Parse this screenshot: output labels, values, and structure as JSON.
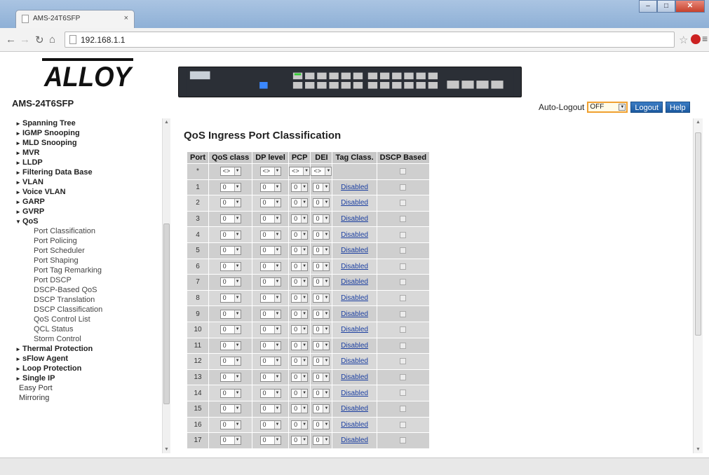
{
  "browser": {
    "tab_title": "AMS-24T6SFP",
    "tab_close": "×",
    "url": "192.168.1.1"
  },
  "header": {
    "logo_text": "ALLOY",
    "model": "AMS-24T6SFP",
    "auto_logout_label": "Auto-Logout",
    "auto_logout_value": "OFF",
    "logout_label": "Logout",
    "help_label": "Help"
  },
  "sidebar": {
    "items": [
      {
        "label": "Spanning Tree",
        "type": "collapsed"
      },
      {
        "label": "IGMP Snooping",
        "type": "collapsed"
      },
      {
        "label": "MLD Snooping",
        "type": "collapsed"
      },
      {
        "label": "MVR",
        "type": "collapsed"
      },
      {
        "label": "LLDP",
        "type": "collapsed"
      },
      {
        "label": "Filtering Data Base",
        "type": "collapsed"
      },
      {
        "label": "VLAN",
        "type": "collapsed"
      },
      {
        "label": "Voice VLAN",
        "type": "collapsed"
      },
      {
        "label": "GARP",
        "type": "collapsed"
      },
      {
        "label": "GVRP",
        "type": "collapsed"
      },
      {
        "label": "QoS",
        "type": "expanded"
      },
      {
        "label": "Port Classification",
        "type": "sub"
      },
      {
        "label": "Port Policing",
        "type": "sub"
      },
      {
        "label": "Port Scheduler",
        "type": "sub"
      },
      {
        "label": "Port Shaping",
        "type": "sub"
      },
      {
        "label": "Port Tag Remarking",
        "type": "sub"
      },
      {
        "label": "Port DSCP",
        "type": "sub"
      },
      {
        "label": "DSCP-Based QoS",
        "type": "sub"
      },
      {
        "label": "DSCP Translation",
        "type": "sub"
      },
      {
        "label": "DSCP Classification",
        "type": "sub"
      },
      {
        "label": "QoS Control List",
        "type": "sub"
      },
      {
        "label": "QCL Status",
        "type": "sub"
      },
      {
        "label": "Storm Control",
        "type": "sub"
      },
      {
        "label": "Thermal Protection",
        "type": "collapsed"
      },
      {
        "label": "sFlow Agent",
        "type": "collapsed"
      },
      {
        "label": "Loop Protection",
        "type": "collapsed"
      },
      {
        "label": "Single IP",
        "type": "collapsed"
      },
      {
        "label": "Easy Port",
        "type": "plain"
      },
      {
        "label": "Mirroring",
        "type": "plain"
      }
    ]
  },
  "main": {
    "title": "QoS Ingress Port Classification",
    "columns": [
      "Port",
      "QoS class",
      "DP level",
      "PCP",
      "DEI",
      "Tag Class.",
      "DSCP Based"
    ],
    "wildcard_row": {
      "port": "*",
      "select_value": "<>"
    },
    "rows": [
      {
        "port": "1",
        "qos_class": "0",
        "dp_level": "0",
        "pcp": "0",
        "dei": "0",
        "tag_class": "Disabled"
      },
      {
        "port": "2",
        "qos_class": "0",
        "dp_level": "0",
        "pcp": "0",
        "dei": "0",
        "tag_class": "Disabled"
      },
      {
        "port": "3",
        "qos_class": "0",
        "dp_level": "0",
        "pcp": "0",
        "dei": "0",
        "tag_class": "Disabled"
      },
      {
        "port": "4",
        "qos_class": "0",
        "dp_level": "0",
        "pcp": "0",
        "dei": "0",
        "tag_class": "Disabled"
      },
      {
        "port": "5",
        "qos_class": "0",
        "dp_level": "0",
        "pcp": "0",
        "dei": "0",
        "tag_class": "Disabled"
      },
      {
        "port": "6",
        "qos_class": "0",
        "dp_level": "0",
        "pcp": "0",
        "dei": "0",
        "tag_class": "Disabled"
      },
      {
        "port": "7",
        "qos_class": "0",
        "dp_level": "0",
        "pcp": "0",
        "dei": "0",
        "tag_class": "Disabled"
      },
      {
        "port": "8",
        "qos_class": "0",
        "dp_level": "0",
        "pcp": "0",
        "dei": "0",
        "tag_class": "Disabled"
      },
      {
        "port": "9",
        "qos_class": "0",
        "dp_level": "0",
        "pcp": "0",
        "dei": "0",
        "tag_class": "Disabled"
      },
      {
        "port": "10",
        "qos_class": "0",
        "dp_level": "0",
        "pcp": "0",
        "dei": "0",
        "tag_class": "Disabled"
      },
      {
        "port": "11",
        "qos_class": "0",
        "dp_level": "0",
        "pcp": "0",
        "dei": "0",
        "tag_class": "Disabled"
      },
      {
        "port": "12",
        "qos_class": "0",
        "dp_level": "0",
        "pcp": "0",
        "dei": "0",
        "tag_class": "Disabled"
      },
      {
        "port": "13",
        "qos_class": "0",
        "dp_level": "0",
        "pcp": "0",
        "dei": "0",
        "tag_class": "Disabled"
      },
      {
        "port": "14",
        "qos_class": "0",
        "dp_level": "0",
        "pcp": "0",
        "dei": "0",
        "tag_class": "Disabled"
      },
      {
        "port": "15",
        "qos_class": "0",
        "dp_level": "0",
        "pcp": "0",
        "dei": "0",
        "tag_class": "Disabled"
      },
      {
        "port": "16",
        "qos_class": "0",
        "dp_level": "0",
        "pcp": "0",
        "dei": "0",
        "tag_class": "Disabled"
      },
      {
        "port": "17",
        "qos_class": "0",
        "dp_level": "0",
        "pcp": "0",
        "dei": "0",
        "tag_class": "Disabled"
      }
    ]
  },
  "colors": {
    "accent_blue": "#1d5aa0",
    "link_blue": "#1a3ea0",
    "table_gray": "#cfcfcf",
    "autologout_border": "#f0a030"
  }
}
